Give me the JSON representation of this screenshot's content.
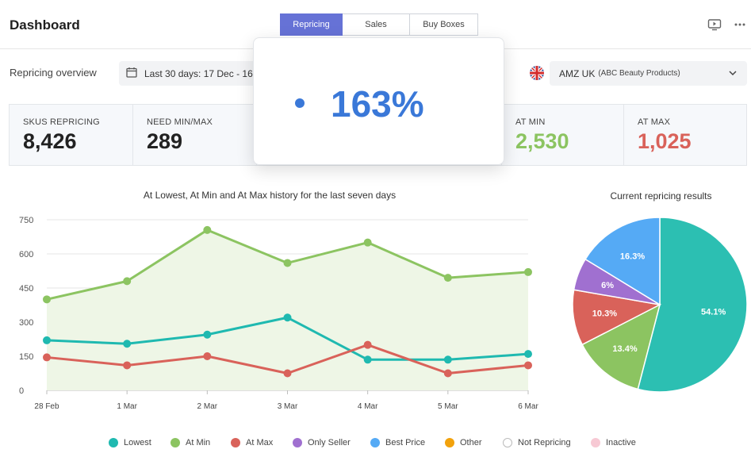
{
  "header": {
    "title": "Dashboard",
    "tabs": [
      {
        "label": "Repricing",
        "active": true
      },
      {
        "label": "Sales",
        "active": false
      },
      {
        "label": "Buy Boxes",
        "active": false
      }
    ],
    "icons": [
      "play-screen-icon",
      "more-icon"
    ]
  },
  "overview": {
    "label": "Repricing overview",
    "date_range": "Last 30 days: 17 Dec - 16",
    "store": "AMZ UK",
    "store_sub": "(ABC Beauty Products)"
  },
  "stats": [
    {
      "label": "SKUS REPRICING",
      "value": "8,426",
      "color": "#222222"
    },
    {
      "label": "NEED MIN/MAX",
      "value": "289",
      "color": "#222222"
    },
    {
      "label": "AT MIN",
      "value": "2,530",
      "color": "#8cc461"
    },
    {
      "label": "AT MAX",
      "value": "1,025",
      "color": "#d9625a"
    }
  ],
  "popup": {
    "value": "163%",
    "color": "#3a78d8"
  },
  "colors": {
    "lowest": "#1fb9b0",
    "at_min": "#8cc461",
    "at_max": "#d9625a",
    "only_seller": "#a070d0",
    "best_price": "#55aaf5",
    "other": "#f2a20c",
    "inactive": "#f7c9d4"
  },
  "chart_data": [
    {
      "type": "line",
      "title": "At Lowest, At Min and At Max history for the last seven days",
      "x": [
        "28 Feb",
        "1 Mar",
        "2 Mar",
        "3 Mar",
        "4 Mar",
        "5 Mar",
        "6 Mar"
      ],
      "yticks": [
        0,
        150,
        300,
        450,
        600,
        750
      ],
      "ylim": [
        0,
        750
      ],
      "grid": true,
      "series": [
        {
          "name": "At Min",
          "color": "#8cc461",
          "fill": true,
          "values": [
            400,
            480,
            705,
            560,
            650,
            495,
            520
          ]
        },
        {
          "name": "Lowest",
          "color": "#1fb9b0",
          "values": [
            220,
            205,
            245,
            320,
            135,
            135,
            160
          ]
        },
        {
          "name": "At Max",
          "color": "#d9625a",
          "values": [
            145,
            110,
            150,
            75,
            200,
            75,
            110
          ]
        }
      ]
    },
    {
      "type": "pie",
      "title": "Current repricing results",
      "slices": [
        {
          "label": "54.1%",
          "value": 54.1,
          "color": "#2cbfb2"
        },
        {
          "label": "13.4%",
          "value": 13.4,
          "color": "#8cc461"
        },
        {
          "label": "10.3%",
          "value": 10.3,
          "color": "#d9625a"
        },
        {
          "label": "6%",
          "value": 6,
          "color": "#a070d0"
        },
        {
          "label": "16.3%",
          "value": 16.3,
          "color": "#55aaf5"
        }
      ]
    }
  ],
  "legend": [
    {
      "label": "Lowest",
      "color": "#1fb9b0"
    },
    {
      "label": "At Min",
      "color": "#8cc461"
    },
    {
      "label": "At Max",
      "color": "#d9625a"
    },
    {
      "label": "Only Seller",
      "color": "#a070d0"
    },
    {
      "label": "Best Price",
      "color": "#55aaf5"
    },
    {
      "label": "Other",
      "color": "#f2a20c"
    },
    {
      "label": "Not Repricing",
      "color": "#ffffff"
    },
    {
      "label": "Inactive",
      "color": "#f7c9d4"
    }
  ]
}
